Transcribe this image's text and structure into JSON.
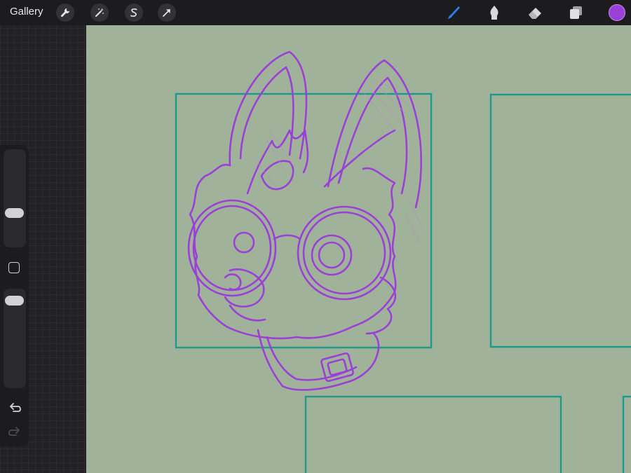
{
  "topbar": {
    "gallery_label": "Gallery",
    "left_tools": [
      "wrench-icon",
      "magic-wand-icon",
      "selection-s-icon",
      "transform-arrow-icon"
    ],
    "right_tools": [
      "brush-icon",
      "smudge-icon",
      "eraser-icon",
      "layers-icon"
    ],
    "active_tool": "brush-icon",
    "current_color": "#9a40d6"
  },
  "sidebar": {
    "controls": [
      "brush-size-slider",
      "modifier-square",
      "opacity-slider",
      "undo-icon",
      "redo-icon"
    ]
  },
  "colors": {
    "canvas_bg": "#a1b29a",
    "panel_lines": "#1e9a8a",
    "sketch_stroke": "#9a40d6",
    "active_tool_blue": "#2f7de8"
  }
}
